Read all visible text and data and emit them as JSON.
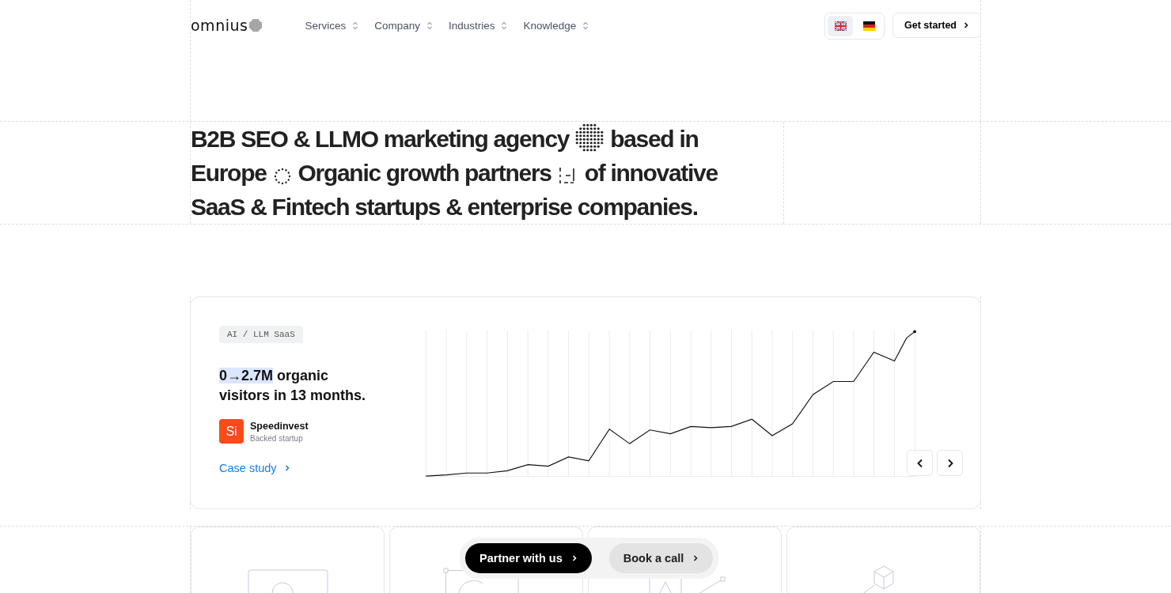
{
  "header": {
    "logo": "omnius",
    "nav": [
      {
        "label": "Services"
      },
      {
        "label": "Company"
      },
      {
        "label": "Industries"
      },
      {
        "label": "Knowledge"
      }
    ],
    "languages": [
      {
        "selected": true
      },
      {
        "selected": false
      }
    ],
    "cta": "Get started"
  },
  "hero": {
    "parts": [
      "B2B SEO & LLMO marketing agency",
      "based in",
      "Europe",
      "Organic growth partners",
      "of innovative",
      "SaaS & Fintech startups & enterprise companies."
    ]
  },
  "case": {
    "tag": "AI / LLM SaaS",
    "highlight": "0→2.7M",
    "headline": "organic visitors in 13 months.",
    "company": {
      "badge": "Si",
      "name": "Speedinvest",
      "subtitle": "Backed startup"
    },
    "link": "Case study"
  },
  "cta_bar": {
    "primary": "Partner with us",
    "secondary": "Book a call"
  }
}
